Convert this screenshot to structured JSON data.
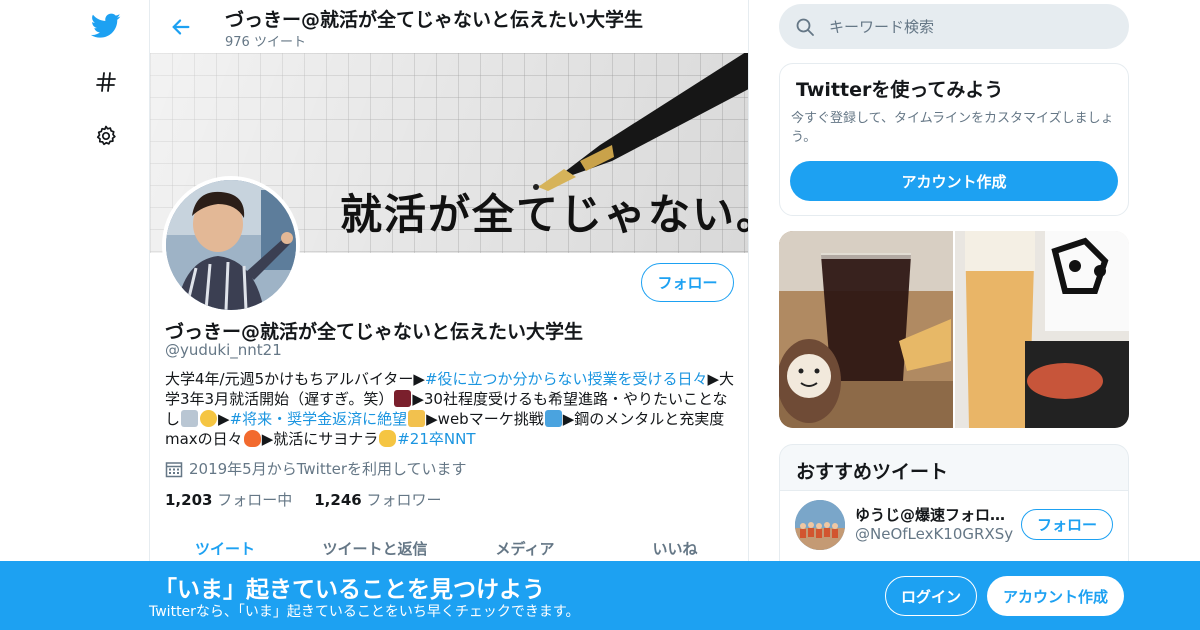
{
  "header": {
    "title": "づっきー@就活が全てじゃないと伝えたい大学生",
    "tweet_count": "976 ツイート"
  },
  "banner": {
    "text": "就活が全てじゃない。"
  },
  "profile": {
    "name": "づっきー@就活が全てじゃないと伝えたい大学生",
    "handle": "@yuduki_nnt21",
    "follow_label": "フォロー",
    "bio": {
      "p1": "大学4年/元週5かけもちアルバイター▶",
      "tag1": "#役に立つか分からない授業を受ける日々",
      "p2": "▶大学3年3月就活開始（遅すぎ。笑）",
      "p3": "▶30社程度受けるも希望進路・やりたいことなし",
      "p4": "▶",
      "tag2": "#将来・奨学金返済に絶望",
      "p5": "▶webマーケ挑戦",
      "p6": "▶鋼のメンタルと充実度maxの日々",
      "p7": "▶就活にサヨナラ",
      "tag3": "#21卒NNT"
    },
    "joined": "2019年5月からTwitterを利用しています",
    "following_count": "1,203",
    "following_label": "フォロー中",
    "followers_count": "1,246",
    "followers_label": "フォロワー"
  },
  "tabs": [
    {
      "label": "ツイート"
    },
    {
      "label": "ツイートと返信"
    },
    {
      "label": "メディア"
    },
    {
      "label": "いいね"
    }
  ],
  "search": {
    "placeholder": "キーワード検索"
  },
  "signup_card": {
    "title": "Twitterを使ってみよう",
    "description": "今すぐ登録して、タイムラインをカスタマイズしましょう。",
    "button": "アカウント作成"
  },
  "recommend": {
    "title": "おすすめツイート",
    "user_name": "ゆうじ@爆速フォロ…",
    "user_handle": "@NeOfLexK10GRXSy",
    "follow_label": "フォロー"
  },
  "bottom_bar": {
    "title": "「いま」起きていることを見つけよう",
    "subtitle": "Twitterなら、「いま」起きていることをいち早くチェックできます。",
    "login": "ログイン",
    "signup": "アカウント作成"
  },
  "colors": {
    "accent": "#1da1f2",
    "link": "#1b95e0",
    "secondary_text": "#657786"
  }
}
